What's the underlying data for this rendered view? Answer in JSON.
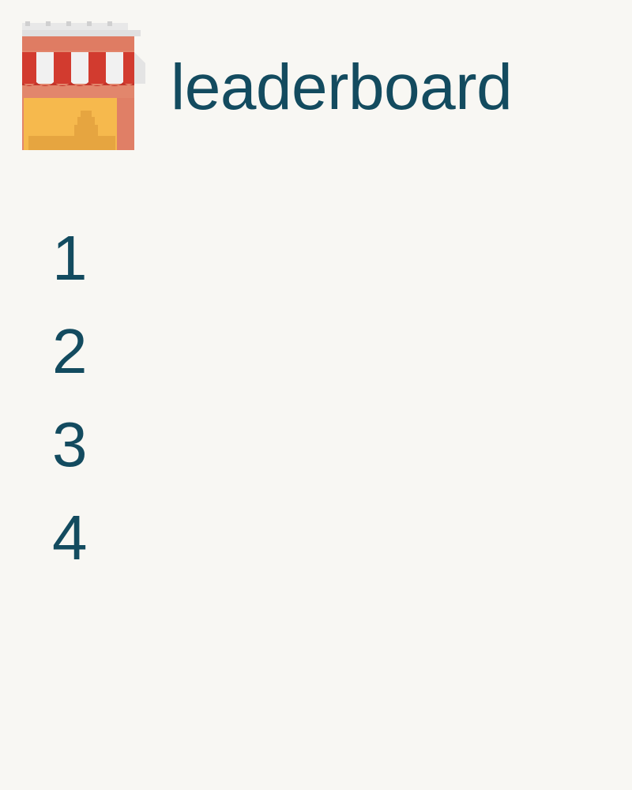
{
  "header": {
    "icon": "storefront-icon",
    "title": "leaderboard"
  },
  "ranks": [
    {
      "label": "1"
    },
    {
      "label": "2"
    },
    {
      "label": "3"
    },
    {
      "label": "4"
    }
  ],
  "colors": {
    "background": "#f8f7f3",
    "text": "#134b5f",
    "awning_red": "#d23b2f",
    "awning_white": "#f1f1f1",
    "shop_wall": "#e2866c",
    "shop_window": "#f6b94d"
  }
}
